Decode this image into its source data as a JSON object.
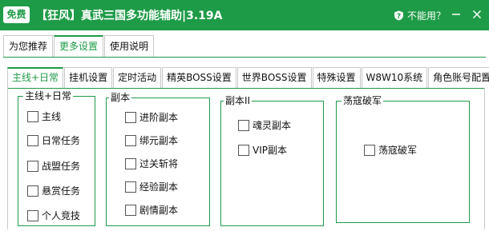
{
  "title_bar": {
    "badge": "免费",
    "title": "【狂风】真武三国多功能辅助|3.19A",
    "help_link": "不能用？"
  },
  "main_tabs": [
    {
      "label": "为您推荐"
    },
    {
      "label": "更多设置"
    },
    {
      "label": "使用说明"
    }
  ],
  "sub_tabs": [
    {
      "label": "主线+日常"
    },
    {
      "label": "挂机设置"
    },
    {
      "label": "定时活动"
    },
    {
      "label": "精英BOSS设置"
    },
    {
      "label": "世界BOSS设置"
    },
    {
      "label": "特殊设置"
    },
    {
      "label": "W8W10系统"
    },
    {
      "label": "角色账号配置"
    }
  ],
  "groups": {
    "main_daily": {
      "title": "主线+日常",
      "items": [
        {
          "label": "主线",
          "checked": false
        },
        {
          "label": "日常任务",
          "checked": false
        },
        {
          "label": "战盟任务",
          "checked": false
        },
        {
          "label": "悬赏任务",
          "checked": false
        },
        {
          "label": "个人竞技",
          "checked": false
        }
      ]
    },
    "dungeon": {
      "title": "副本",
      "items": [
        {
          "label": "进阶副本",
          "checked": false
        },
        {
          "label": "绑元副本",
          "checked": false
        },
        {
          "label": "过关斩将",
          "checked": false
        },
        {
          "label": "经验副本",
          "checked": false
        },
        {
          "label": "剧情副本",
          "checked": false
        }
      ]
    },
    "dungeon2": {
      "title": "副本II",
      "items": [
        {
          "label": "魂灵副本",
          "checked": false
        },
        {
          "label": "VIP副本",
          "checked": false
        }
      ]
    },
    "pojun": {
      "title": "荡寇破军",
      "items": [
        {
          "label": "荡寇破军",
          "checked": false
        }
      ]
    }
  },
  "colors": {
    "accent": "#1e9b47",
    "tab_border": "#c9c9c9"
  },
  "icons": {
    "help": "question-shield-icon",
    "minimize": "minimize-icon",
    "close": "close-icon"
  }
}
